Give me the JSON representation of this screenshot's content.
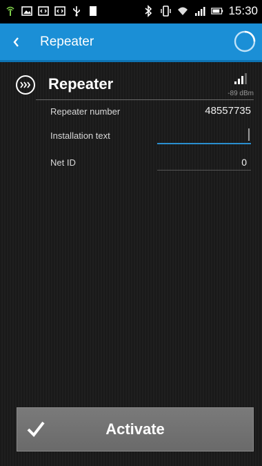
{
  "status_bar": {
    "time": "15:30",
    "left_icons": [
      "wifi-ap-icon",
      "image-icon",
      "code-box-icon",
      "code-box-icon",
      "usb-icon",
      "battery-full-icon"
    ],
    "right_icons": [
      "bluetooth-icon",
      "vibrate-icon",
      "wifi-icon",
      "cell-signal-icon",
      "battery-icon"
    ]
  },
  "action_bar": {
    "title": "Repeater",
    "back_icon": "chevron-left-icon",
    "progress_icon": "spinner-icon",
    "color": "#1b8fd6"
  },
  "device": {
    "title": "Repeater",
    "icon": "forward-dots-icon",
    "signal": {
      "strength_text": "-89 dBm",
      "icon": "signal-bars-icon"
    }
  },
  "fields": {
    "repeater_number": {
      "label": "Repeater number",
      "value": "48557735"
    },
    "installation_text": {
      "label": "Installation text",
      "value": ""
    },
    "net_id": {
      "label": "Net ID",
      "value": "0"
    }
  },
  "activate": {
    "label": "Activate",
    "icon": "checkmark-icon"
  },
  "colors": {
    "accent": "#2a8fd0",
    "button": "#707070"
  }
}
